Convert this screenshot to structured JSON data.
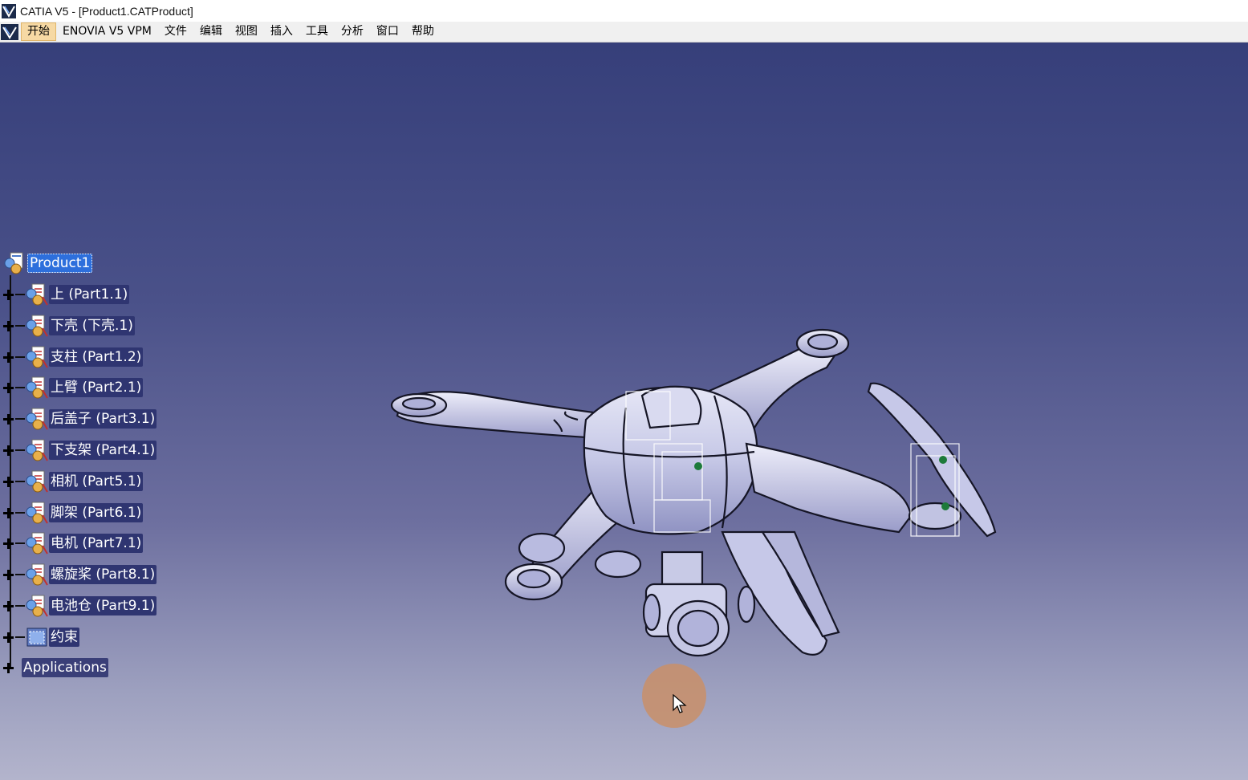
{
  "window": {
    "title": "CATIA V5 - [Product1.CATProduct]"
  },
  "menubar": {
    "items": [
      "开始",
      "ENOVIA V5 VPM",
      "文件",
      "编辑",
      "视图",
      "插入",
      "工具",
      "分析",
      "窗口",
      "帮助"
    ],
    "active_index": 0
  },
  "tree": {
    "root": "Product1",
    "children": [
      {
        "label": "上 (Part1.1)",
        "icon": "part-icon"
      },
      {
        "label": "下壳 (下壳.1)",
        "icon": "part-icon"
      },
      {
        "label": "支柱 (Part1.2)",
        "icon": "part-icon"
      },
      {
        "label": "上臂 (Part2.1)",
        "icon": "part-icon"
      },
      {
        "label": "后盖子 (Part3.1)",
        "icon": "part-icon"
      },
      {
        "label": "下支架 (Part4.1)",
        "icon": "part-icon"
      },
      {
        "label": "相机 (Part5.1)",
        "icon": "part-icon"
      },
      {
        "label": "脚架 (Part6.1)",
        "icon": "part-icon"
      },
      {
        "label": "电机 (Part7.1)",
        "icon": "part-icon"
      },
      {
        "label": "螺旋桨 (Part8.1)",
        "icon": "part-icon"
      },
      {
        "label": "电池仓 (Part9.1)",
        "icon": "part-icon"
      },
      {
        "label": "约束",
        "icon": "constraints-icon"
      }
    ],
    "applications": "Applications"
  },
  "colors": {
    "viewport_top": "#363f7a",
    "viewport_bottom": "#b3b4cc",
    "model_fill": "#c9cbe8",
    "selection_highlight": "#2d6fdc",
    "menu_active": "#f6d9a4"
  }
}
